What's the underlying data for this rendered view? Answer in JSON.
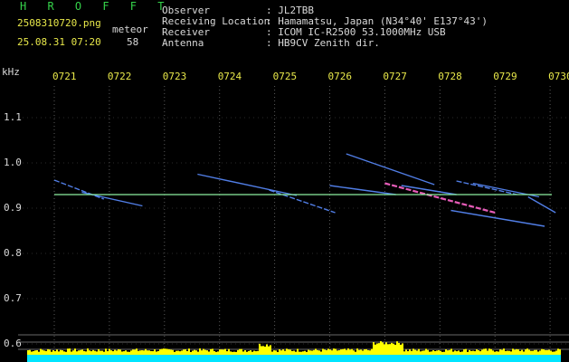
{
  "header": {
    "app_name": "H R O F F T",
    "filename": "2508310720.png",
    "datetime": "25.08.31 07:20",
    "detection_label": "meteor",
    "detection_count": "58",
    "info_labels": [
      "Observer",
      "Receiving Location",
      "Receiver",
      "Antenna"
    ],
    "info_values": [
      ": JL2TBB",
      ": Hamamatsu, Japan (N34°40' E137°43')",
      ": ICOM IC-R2500 53.1000MHz USB",
      ": HB9CV Zenith dir."
    ]
  },
  "chart_data": {
    "type": "heatmap",
    "ylabel": "kHz",
    "x_ticks": [
      "0721",
      "0722",
      "0723",
      "0724",
      "0725",
      "0726",
      "0727",
      "0728",
      "0729",
      "0730"
    ],
    "y_ticks": [
      "1.1",
      "1.0",
      "0.9",
      "0.8",
      "0.7",
      "0.6"
    ],
    "ylim": [
      0.58,
      1.2
    ],
    "carrier_khz": 0.93,
    "traces": [
      {
        "x": [
          0.0,
          0.9
        ],
        "y": [
          0.962,
          0.92
        ]
      },
      {
        "x": [
          0.5,
          1.6
        ],
        "y": [
          0.935,
          0.905
        ]
      },
      {
        "x": [
          2.6,
          4.4
        ],
        "y": [
          0.975,
          0.928
        ]
      },
      {
        "x": [
          3.9,
          5.1
        ],
        "y": [
          0.94,
          0.89
        ]
      },
      {
        "x": [
          5.0,
          6.2
        ],
        "y": [
          0.95,
          0.93
        ]
      },
      {
        "x": [
          5.3,
          6.9
        ],
        "y": [
          1.02,
          0.952
        ]
      },
      {
        "x": [
          6.0,
          8.0
        ],
        "y": [
          0.955,
          0.89
        ]
      },
      {
        "x": [
          6.3,
          7.3
        ],
        "y": [
          0.95,
          0.93
        ]
      },
      {
        "x": [
          7.2,
          8.9
        ],
        "y": [
          0.895,
          0.86
        ]
      },
      {
        "x": [
          7.3,
          8.4
        ],
        "y": [
          0.96,
          0.93
        ]
      },
      {
        "x": [
          7.6,
          8.8
        ],
        "y": [
          0.955,
          0.925
        ]
      },
      {
        "x": [
          8.6,
          9.1
        ],
        "y": [
          0.925,
          0.89
        ]
      }
    ]
  },
  "colors": {
    "carrier": "#8cf0a0",
    "trace": "#5a8cff",
    "hot": "#ff66cc",
    "spectrum": "#00e5ff",
    "spectrum_peak": "#ffff00"
  }
}
